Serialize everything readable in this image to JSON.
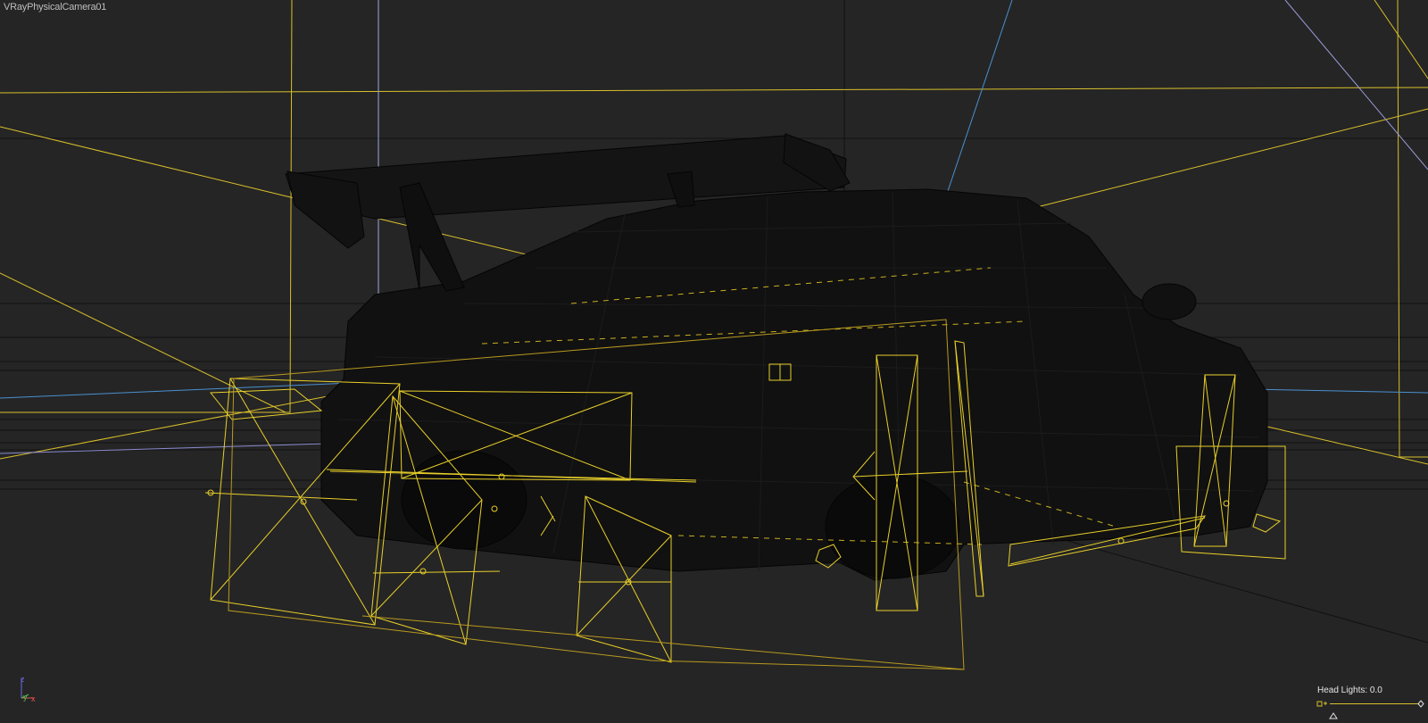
{
  "viewport": {
    "label": "VRayPhysicalCamera01",
    "background": "#252525",
    "wire_color": "#e8cf2a",
    "axis": {
      "x": "x",
      "y": "y",
      "z": "z"
    }
  },
  "head_lights": {
    "label": "Head Lights: 0.0",
    "value": 0.0
  }
}
